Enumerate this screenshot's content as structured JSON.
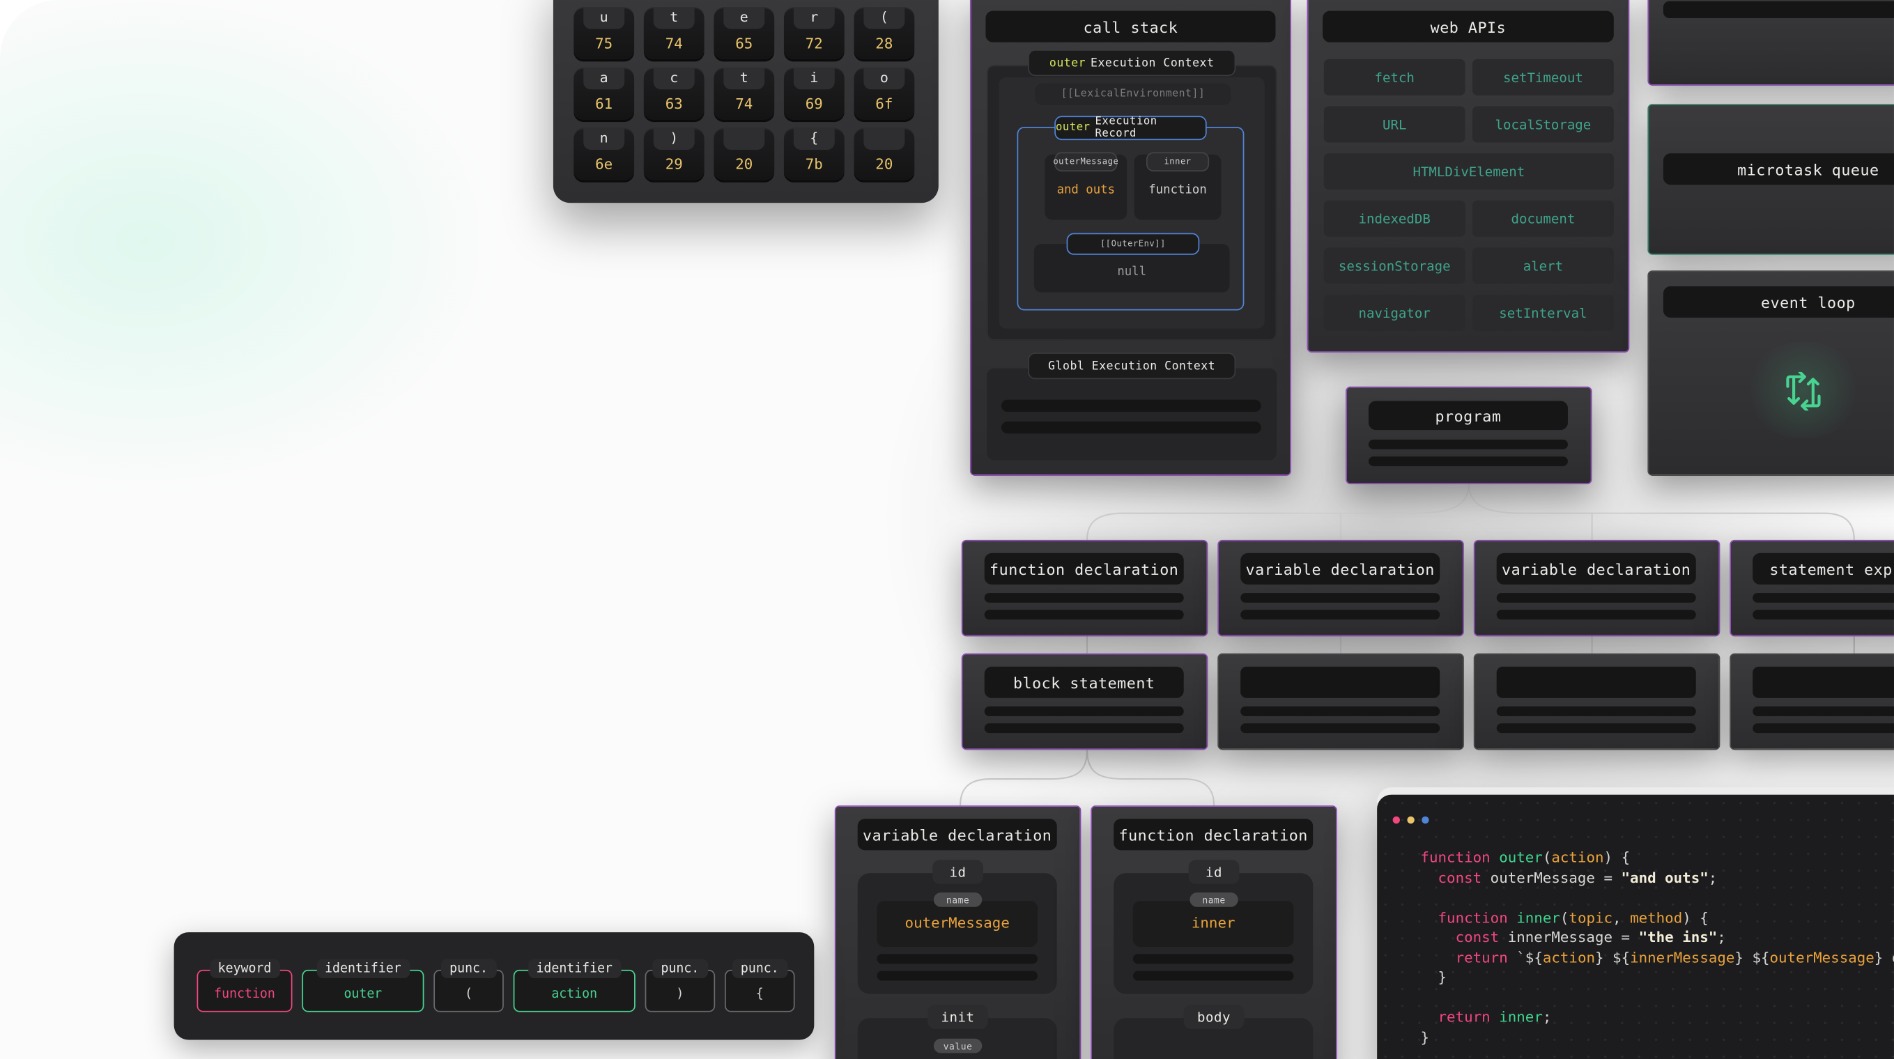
{
  "keyboard": {
    "keys": [
      {
        "char": "u",
        "hex": "75"
      },
      {
        "char": "t",
        "hex": "74"
      },
      {
        "char": "e",
        "hex": "65"
      },
      {
        "char": "r",
        "hex": "72"
      },
      {
        "char": "(",
        "hex": "28"
      },
      {
        "char": "a",
        "hex": "61"
      },
      {
        "char": "c",
        "hex": "63"
      },
      {
        "char": "t",
        "hex": "74"
      },
      {
        "char": "i",
        "hex": "69"
      },
      {
        "char": "o",
        "hex": "6f"
      },
      {
        "char": "n",
        "hex": "6e"
      },
      {
        "char": ")",
        "hex": "29"
      },
      {
        "char": "",
        "hex": "20"
      },
      {
        "char": "{",
        "hex": "7b"
      },
      {
        "char": "",
        "hex": "20"
      }
    ]
  },
  "call_stack": {
    "title": "call stack",
    "outer_context_keyword": "outer",
    "outer_context_label": "Execution Context",
    "lexical_env": "[[LexicalEnvironment]]",
    "record_keyword": "outer",
    "record_label": "Execution Record",
    "binding1_name": "outerMessage",
    "binding1_value": "and outs",
    "binding2_name": "inner",
    "binding2_value": "function",
    "outer_env": "[[OuterEnv]]",
    "outer_env_value": "null",
    "global_context": "Globl Execution Context"
  },
  "web_apis": {
    "title": "web APIs",
    "items": [
      "fetch",
      "setTimeout",
      "URL",
      "localStorage",
      "HTMLDivElement",
      "indexedDB",
      "document",
      "sessionStorage",
      "alert",
      "navigator",
      "setInterval"
    ]
  },
  "microtask_queue": {
    "title": "microtask queue"
  },
  "event_loop": {
    "title": "event loop"
  },
  "program": {
    "title": "program"
  },
  "ast_row1": [
    "function declaration",
    "variable declaration",
    "variable declaration",
    "statement expre"
  ],
  "ast_row2": [
    "block statement"
  ],
  "var_decl": {
    "title": "variable declaration",
    "id": "id",
    "name_tag": "name",
    "name": "outerMessage",
    "init": "init",
    "value_tag": "value"
  },
  "func_decl": {
    "title": "function declaration",
    "id": "id",
    "name_tag": "name",
    "name": "inner",
    "body": "body"
  },
  "tokens": [
    {
      "type": "keyword",
      "value": "function",
      "color": "#f2477f"
    },
    {
      "type": "identifier",
      "value": "outer",
      "color": "#49d391"
    },
    {
      "type": "punc.",
      "value": "(",
      "color": "#d6d6d4"
    },
    {
      "type": "identifier",
      "value": "action",
      "color": "#49d391"
    },
    {
      "type": "punc.",
      "value": ")",
      "color": "#d6d6d4"
    },
    {
      "type": "punc.",
      "value": "{",
      "color": "#d6d6d4"
    }
  ],
  "code_lines": [
    "function outer(action) {",
    "  const outerMessage = \"and outs\";",
    "",
    "  function inner(topic, method) {",
    "    const innerMessage = \"the ins\";",
    "    return `${action} ${innerMessage} ${outerMessage} of $",
    "  }",
    "",
    "  return inner;",
    "}"
  ],
  "colors": {
    "accent_purple": "#8e4bb6",
    "accent_green": "#49d391",
    "keyword_pink": "#f2477f",
    "value_yellow": "#e9c46a"
  }
}
